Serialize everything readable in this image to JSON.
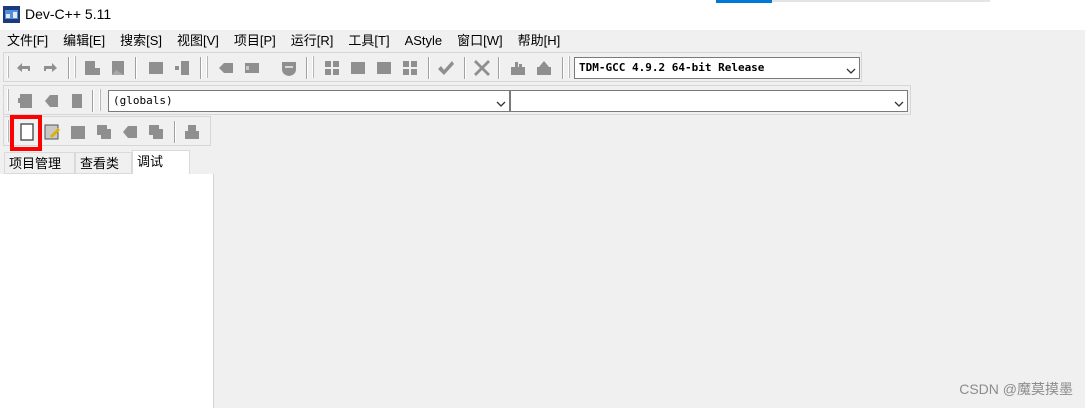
{
  "window": {
    "title": "Dev-C++ 5.11",
    "app_icon": "devcpp-app-icon"
  },
  "menu": [
    "文件[F]",
    "编辑[E]",
    "搜索[S]",
    "视图[V]",
    "项目[P]",
    "运行[R]",
    "工具[T]",
    "AStyle",
    "窗口[W]",
    "帮助[H]"
  ],
  "toolbar": {
    "compiler_select": "TDM-GCC 4.9.2 64-bit Release",
    "class_select": "(globals)",
    "member_select": ""
  },
  "left_panel": {
    "tabs": [
      "项目管理",
      "查看类",
      "调试"
    ],
    "active_tab": 2
  },
  "watermark": "CSDN @魔莫摸墨",
  "colors": {
    "accent": "#0078d7",
    "highlight_box": "#ff0000",
    "icon_gray": "#8f8f8f",
    "background": "#f0f0f0"
  }
}
